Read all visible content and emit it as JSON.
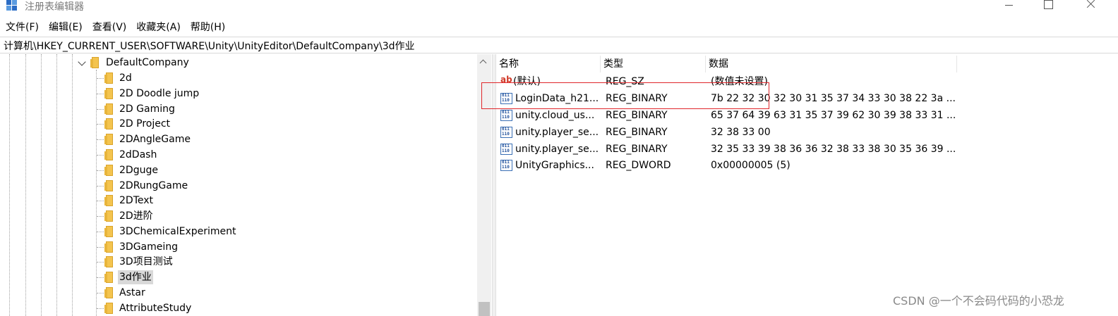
{
  "window": {
    "title": "注册表编辑器"
  },
  "menu": [
    "文件(F)",
    "编辑(E)",
    "查看(V)",
    "收藏夹(A)",
    "帮助(H)"
  ],
  "address": "计算机\\HKEY_CURRENT_USER\\SOFTWARE\\Unity\\UnityEditor\\DefaultCompany\\3d作业",
  "tree": {
    "parent": "DefaultCompany",
    "children": [
      "2d",
      "2D Doodle jump",
      "2D Gaming",
      "2D Project",
      "2DAngleGame",
      "2dDash",
      "2Dguge",
      "2DRungGame",
      "2DText",
      "2D进阶",
      "3DChemicalExperiment",
      "3DGameing",
      "3D项目测试",
      "3d作业",
      "Astar",
      "AttributeStudy"
    ],
    "selected": "3d作业"
  },
  "list": {
    "columns": [
      "名称",
      "类型",
      "数据"
    ],
    "rows": [
      {
        "icon": "string-value-icon",
        "name": "(默认)",
        "type": "REG_SZ",
        "data": "(数值未设置)"
      },
      {
        "icon": "binary-value-icon",
        "name": "LoginData_h21...",
        "type": "REG_BINARY",
        "data": "7b 22 32 30 32 30 31 35 37 34 33 30 38 22 3a ..."
      },
      {
        "icon": "binary-value-icon",
        "name": "unity.cloud_us...",
        "type": "REG_BINARY",
        "data": "65 37 64 39 63 31 35 37 39 62 30 39 38 33 31 ..."
      },
      {
        "icon": "binary-value-icon",
        "name": "unity.player_se...",
        "type": "REG_BINARY",
        "data": "32 38 33 00"
      },
      {
        "icon": "binary-value-icon",
        "name": "unity.player_se...",
        "type": "REG_BINARY",
        "data": "32 35 33 39 38 36 36 32 38 33 38 30 35 36 39 ..."
      },
      {
        "icon": "binary-value-icon",
        "name": "UnityGraphics...",
        "type": "REG_DWORD",
        "data": "0x00000005 (5)"
      }
    ]
  },
  "annotation_color": "#e0262a",
  "watermark": "CSDN @一个不会码代码的小恐龙"
}
